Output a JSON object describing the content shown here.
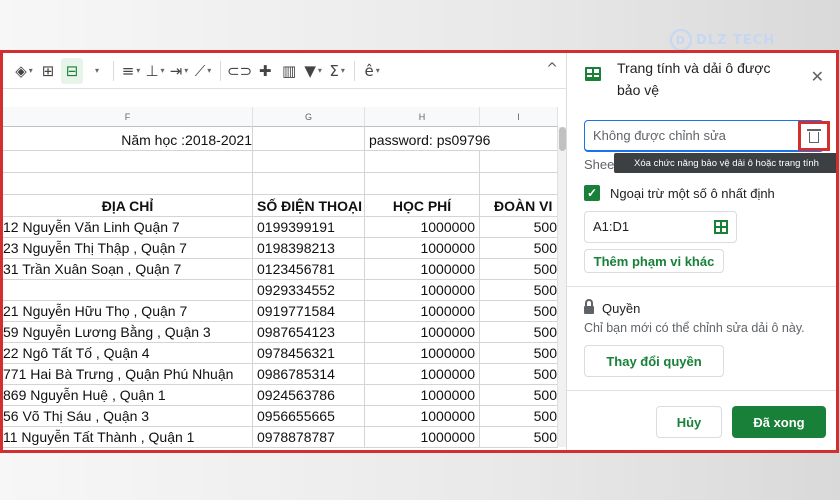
{
  "watermark": {
    "text": "DLZ TECH",
    "logo": "D"
  },
  "toolbar": {
    "icons": [
      "paint-format",
      "borders",
      "merge-cells",
      "align-horizontal",
      "align-vertical",
      "text-wrap",
      "text-rotation",
      "link",
      "comment",
      "chart",
      "filter",
      "functions",
      "input-tools"
    ],
    "collapse": "^"
  },
  "columns": {
    "F": "F",
    "G": "G",
    "H": "H",
    "I": "I"
  },
  "sheet": {
    "school_year": "Năm học :2018-2021",
    "password": "password: ps09796",
    "headers": {
      "address": "ĐỊA CHỈ",
      "phone": "SỐ ĐIỆN THOẠI",
      "fee": "HỌC PHÍ",
      "union": "ĐOÀN VI"
    },
    "rows": [
      {
        "address": "12 Nguyễn Văn Linh Quận 7",
        "phone": "0199399191",
        "fee": "1000000",
        "union": "500"
      },
      {
        "address": "23 Nguyễn Thị Thập , Quận 7",
        "phone": "0198398213",
        "fee": "1000000",
        "union": "500"
      },
      {
        "address": "31 Trần Xuân Soạn , Quận 7",
        "phone": "0123456781",
        "fee": "1000000",
        "union": "500"
      },
      {
        "address": "",
        "phone": "0929334552",
        "fee": "1000000",
        "union": "500"
      },
      {
        "address": "21 Nguyễn Hữu Thọ , Quận 7",
        "phone": "0919771584",
        "fee": "1000000",
        "union": "500"
      },
      {
        "address": "59 Nguyễn Lương Bằng , Quận 3",
        "phone": "0987654123",
        "fee": "1000000",
        "union": "500"
      },
      {
        "address": "22 Ngô Tất Tố , Quận 4",
        "phone": "0978456321",
        "fee": "1000000",
        "union": "500"
      },
      {
        "address": "771 Hai Bà Trưng , Quận Phú Nhuận",
        "phone": "0986785314",
        "fee": "1000000",
        "union": "500"
      },
      {
        "address": "869 Nguyễn Huệ , Quận 1",
        "phone": "0924563786",
        "fee": "1000000",
        "union": "500"
      },
      {
        "address": "56 Võ Thị Sáu , Quận 3",
        "phone": "0956655665",
        "fee": "1000000",
        "union": "500"
      },
      {
        "address": "11  Nguyễn Tất Thành , Quận 1",
        "phone": "0978878787",
        "fee": "1000000",
        "union": "500"
      }
    ]
  },
  "panel": {
    "title": "Trang tính và dải ô được bảo vệ",
    "close": "✕",
    "description_value": "Không được chỉnh sửa",
    "delete_tooltip": "Xóa chức năng bảo vệ dải ô hoặc trang tính",
    "sheet_tab_hint": "Shee",
    "except_label": "Ngoại trừ một số ô nhất định",
    "range_value": "A1:D1",
    "add_range": "Thêm phạm vi khác",
    "permissions_title": "Quyền",
    "permissions_desc": "Chỉ bạn mới có thể chỉnh sửa dải ô này.",
    "change_permissions": "Thay đổi quyền",
    "cancel": "Hủy",
    "done": "Đã xong"
  }
}
